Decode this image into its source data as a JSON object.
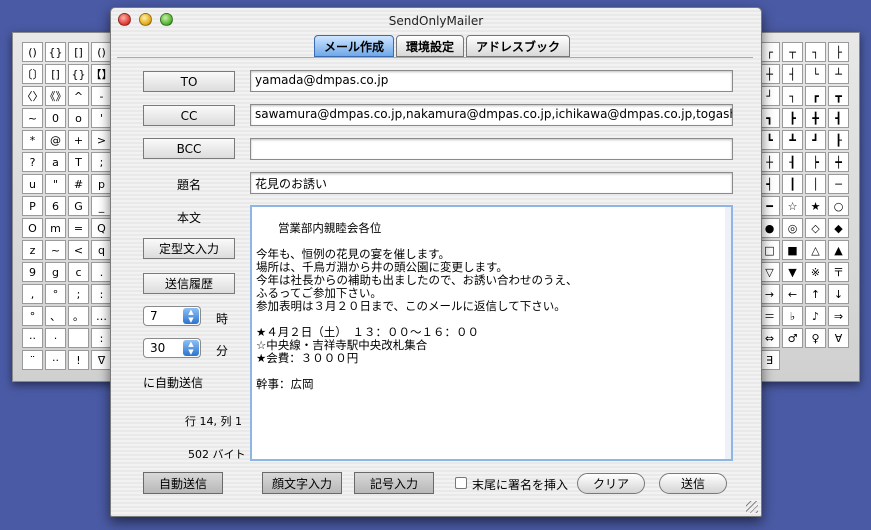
{
  "window": {
    "title": "SendOnlyMailer"
  },
  "tabs": [
    {
      "label": "メール作成",
      "active": true
    },
    {
      "label": "環境設定",
      "active": false
    },
    {
      "label": "アドレスブック",
      "active": false
    }
  ],
  "form": {
    "to_label": "TO",
    "to_value": "yamada@dmpas.co.jp",
    "cc_label": "CC",
    "cc_value": "sawamura@dmpas.co.jp,nakamura@dmpas.co.jp,ichikawa@dmpas.co.jp,togashi@",
    "bcc_label": "BCC",
    "bcc_value": "",
    "subject_label": "題名",
    "subject_value": "花見のお誘い",
    "body_label": "本文",
    "body_value": "営業部内親睦会各位\n\n今年も、恒例の花見の宴を催します。\n場所は、千鳥ガ淵から井の頭公園に変更します。\n今年は社長からの補助も出ましたので、お誘い合わせのうえ、\nふるってご参加下さい。\n参加表明は３月２０日まで、このメールに返信して下さい。\n\n★４月２日（土）　１３：００〜１６：００\n☆中央線・吉祥寺駅中央改札集合\n★会費：３０００円\n\n幹事：広岡"
  },
  "side": {
    "template_button": "定型文入力",
    "history_button": "送信履歴",
    "hour_value": "7",
    "hour_unit": "時",
    "minute_value": "30",
    "minute_unit": "分",
    "auto_send_note": "に自動送信",
    "cursor_position": "行 14, 列 1",
    "byte_count": "502 バイト"
  },
  "footer": {
    "auto_send": "自動送信",
    "emoticon": "顔文字入力",
    "symbol": "記号入力",
    "signature_checkbox": "末尾に署名を挿入",
    "signature_checked": false,
    "clear": "クリア",
    "send": "送信"
  },
  "left_palette": [
    "()",
    "{}",
    "[]",
    "()",
    "〔〕",
    "[]",
    "{}",
    "【】",
    "〈〉",
    "《》",
    "^",
    "-",
    "~",
    "0",
    "o",
    "'",
    "*",
    "@",
    "+",
    ">",
    "?",
    "a",
    "T",
    ";",
    "u",
    "\"",
    "#",
    "p",
    "P",
    "6",
    "G",
    "_",
    "O",
    "m",
    "=",
    "Q",
    "z",
    "~",
    "<",
    "q",
    "9",
    "g",
    "c",
    ".",
    ",",
    "°",
    ";",
    ":",
    "°",
    "、",
    "。",
    "…",
    "··",
    "·",
    "",
    ":",
    "¨",
    "··",
    "!",
    "∇"
  ],
  "right_palette": [
    "┌",
    "┬",
    "┐",
    "├",
    "┼",
    "┤",
    "└",
    "┴",
    "┘",
    "┐",
    "┏",
    "┳",
    "┓",
    "┣",
    "╋",
    "┫",
    "┗",
    "┻",
    "┛",
    "┠",
    "┼",
    "┨",
    "┝",
    "┿",
    "┥",
    "┃",
    "│",
    "─",
    "━",
    "☆",
    "★",
    "○",
    "●",
    "◎",
    "◇",
    "◆",
    "□",
    "■",
    "△",
    "▲",
    "▽",
    "▼",
    "※",
    "〒",
    "→",
    "←",
    "↑",
    "↓",
    "＝",
    "♭",
    "♪",
    "⇒",
    "⇔",
    "♂",
    "♀",
    "∀",
    "∃"
  ]
}
